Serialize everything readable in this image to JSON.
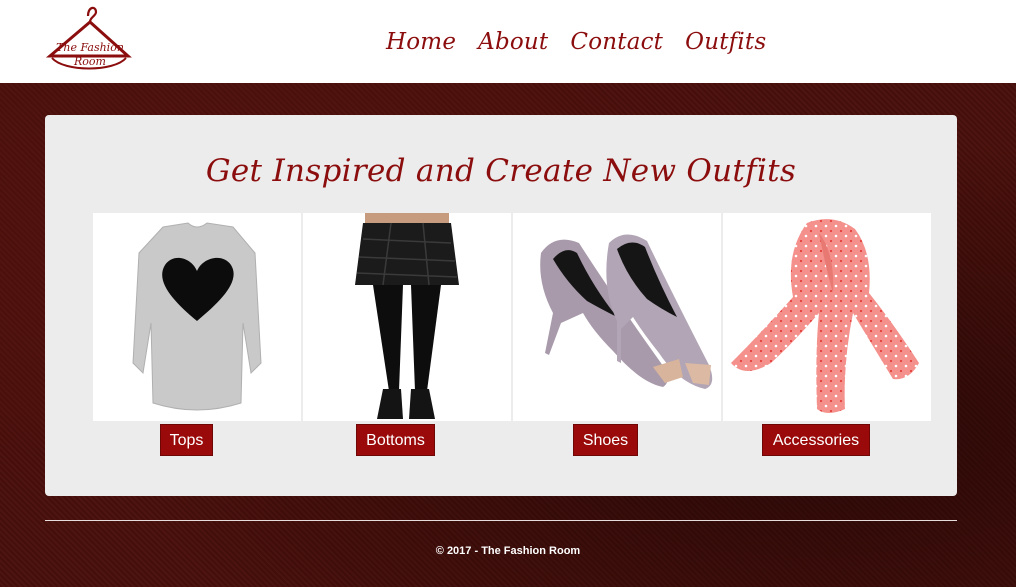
{
  "logo": {
    "text_line1": "The Fashion",
    "text_line2": "Room"
  },
  "nav": {
    "items": [
      "Home",
      "About",
      "Contact",
      "Outfits"
    ]
  },
  "main": {
    "title": "Get Inspired and Create New Outfits",
    "categories": [
      {
        "label": "Tops",
        "image": "grey-heart-sweater"
      },
      {
        "label": "Bottoms",
        "image": "black-quilted-skirt-leggings"
      },
      {
        "label": "Shoes",
        "image": "lilac-pointed-heels"
      },
      {
        "label": "Accessories",
        "image": "pink-bow-scarf"
      }
    ]
  },
  "footer": {
    "text": "© 2017 - The Fashion Room"
  },
  "colors": {
    "brand": "#8b0d0d",
    "button": "#9a0a0a",
    "panel": "#ececec",
    "background": "#4a0f0b"
  }
}
